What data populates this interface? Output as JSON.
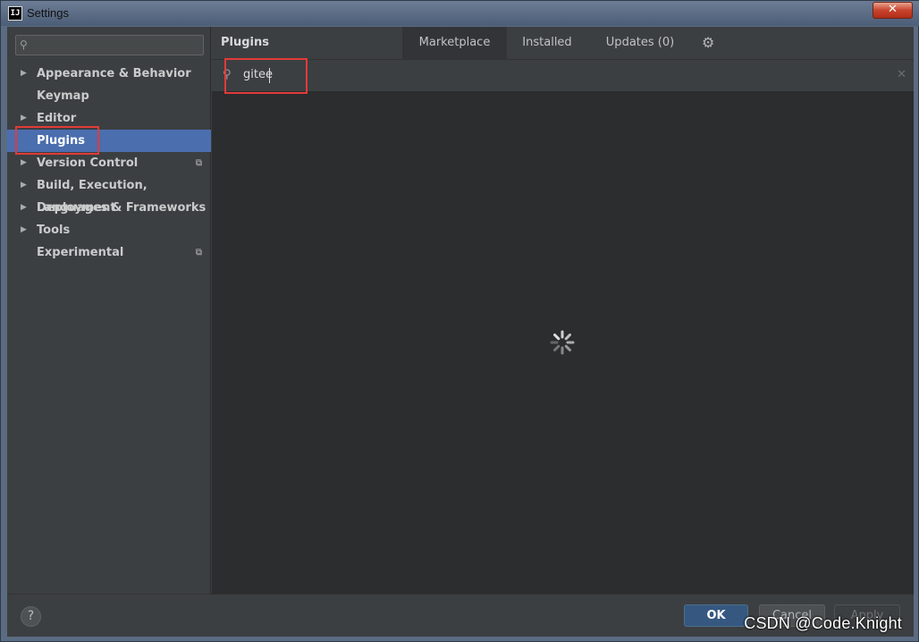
{
  "window": {
    "title": "Settings",
    "app_icon_text": "IJ",
    "close_glyph": "✕"
  },
  "sidebar": {
    "search": {
      "value": "",
      "icon": "search-icon"
    },
    "items": [
      {
        "label": "Appearance & Behavior",
        "expandable": true,
        "selected": false,
        "project_icon": false
      },
      {
        "label": "Keymap",
        "expandable": false,
        "selected": false,
        "project_icon": false
      },
      {
        "label": "Editor",
        "expandable": true,
        "selected": false,
        "project_icon": false
      },
      {
        "label": "Plugins",
        "expandable": false,
        "selected": true,
        "project_icon": false
      },
      {
        "label": "Version Control",
        "expandable": true,
        "selected": false,
        "project_icon": true
      },
      {
        "label": "Build, Execution, Deployment",
        "expandable": true,
        "selected": false,
        "project_icon": false
      },
      {
        "label": "Languages & Frameworks",
        "expandable": true,
        "selected": false,
        "project_icon": false
      },
      {
        "label": "Tools",
        "expandable": true,
        "selected": false,
        "project_icon": false
      },
      {
        "label": "Experimental",
        "expandable": false,
        "selected": false,
        "project_icon": true
      }
    ]
  },
  "plugins": {
    "title": "Plugins",
    "tabs": [
      {
        "label": "Marketplace",
        "active": true
      },
      {
        "label": "Installed",
        "active": false
      },
      {
        "label": "Updates (0)",
        "active": false
      }
    ],
    "search": {
      "value": "gitee",
      "icon": "search-icon",
      "clear_glyph": "✕"
    },
    "loading": true
  },
  "footer": {
    "help_label": "?",
    "ok_label": "OK",
    "cancel_label": "Cancel",
    "apply_label": "Apply"
  },
  "watermark": "CSDN @Code.Knight",
  "colors": {
    "selection": "#4b6eaf",
    "highlight_box": "#e23a3a",
    "ok_button": "#365880"
  }
}
